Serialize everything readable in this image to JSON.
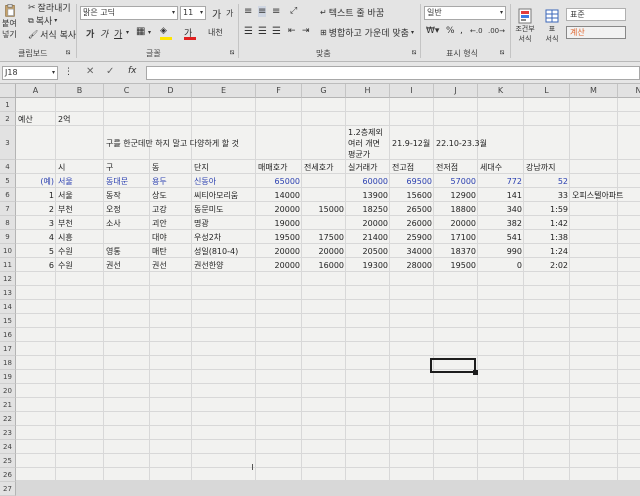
{
  "ribbon": {
    "clipboard": {
      "cut_label": "잘라내기",
      "copy_label": "복사",
      "paste_label": "붙여넣기",
      "format_painter_label": "서식 복사",
      "group_label": "클립보드"
    },
    "font": {
      "name": "맑은 고딕",
      "size": "11",
      "grow": "가",
      "shrink": "가",
      "bold": "가",
      "italic": "가",
      "underline": "가",
      "strike": "가",
      "font_color_letter": "가",
      "phonetic": "내천",
      "group_label": "글꼴"
    },
    "alignment": {
      "wrap_label": "텍스트 줄 바꿈",
      "merge_label": "병합하고 가운데 맞춤",
      "group_label": "맞춤"
    },
    "number": {
      "format": "일반",
      "percent": "%",
      "comma": ",",
      "group_label": "표시 형식"
    },
    "styles": {
      "conditional_label": "조건부",
      "conditional_label2": "서식",
      "table_label": "표",
      "table_label2": "서식",
      "normal_label": "표준",
      "calc_label": "계산"
    }
  },
  "formula_bar": {
    "name_box": "J18",
    "fx_label": "fx",
    "value": ""
  },
  "columns": [
    "A",
    "B",
    "C",
    "D",
    "E",
    "F",
    "G",
    "H",
    "I",
    "J",
    "K",
    "L",
    "M",
    "N"
  ],
  "rows": [
    "1",
    "2",
    "3",
    "4",
    "5",
    "6",
    "7",
    "8",
    "9",
    "10",
    "11",
    "12",
    "13",
    "14",
    "15",
    "16",
    "17",
    "18",
    "19",
    "20",
    "21",
    "22",
    "23",
    "24",
    "25",
    "26",
    "27"
  ],
  "sheet": {
    "a2": "예산",
    "b2": "2억",
    "c3": "구를 한군데만 하지 말고 다양하게 할 것",
    "h3": "1.2층제외\n여러 개면\n평균가",
    "i3": "21.9-12월",
    "j3": "22.10-23.3월",
    "headers": [
      "시",
      "구",
      "동",
      "단지",
      "매매호가",
      "전세호가",
      "실거래가",
      "전고점",
      "전저점",
      "세대수",
      "강남까지"
    ],
    "data_rows": [
      {
        "a": "(예)",
        "b": "서울",
        "c": "동대문",
        "d": "용두",
        "e": "신동아",
        "f": "65000",
        "g": "",
        "h": "60000",
        "i": "69500",
        "j": "57000",
        "k": "772",
        "l": "52",
        "m": ""
      },
      {
        "a": "1",
        "b": "서울",
        "c": "동작",
        "d": "상도",
        "e": "씨티아모리움",
        "f": "14000",
        "g": "",
        "h": "13900",
        "i": "15600",
        "j": "12900",
        "k": "141",
        "l": "33",
        "m": "오피스텔아파트"
      },
      {
        "a": "2",
        "b": "부천",
        "c": "오정",
        "d": "고강",
        "e": "동문미도",
        "f": "20000",
        "g": "15000",
        "h": "18250",
        "i": "26500",
        "j": "18800",
        "k": "340",
        "l": "1:59",
        "m": ""
      },
      {
        "a": "3",
        "b": "부천",
        "c": "소사",
        "d": "괴안",
        "e": "명광",
        "f": "19000",
        "g": "",
        "h": "20000",
        "i": "26000",
        "j": "20000",
        "k": "382",
        "l": "1:42",
        "m": ""
      },
      {
        "a": "4",
        "b": "시흥",
        "c": "",
        "d": "대야",
        "e": "우성2차",
        "f": "19500",
        "g": "17500",
        "h": "21400",
        "i": "25900",
        "j": "17100",
        "k": "541",
        "l": "1:38",
        "m": ""
      },
      {
        "a": "5",
        "b": "수원",
        "c": "영통",
        "d": "매탄",
        "e": "성일(810-4)",
        "f": "20000",
        "g": "20000",
        "h": "20500",
        "i": "34000",
        "j": "18370",
        "k": "990",
        "l": "1:24",
        "m": ""
      },
      {
        "a": "6",
        "b": "수원",
        "c": "권선",
        "d": "권선",
        "e": "권선한양",
        "f": "20000",
        "g": "16000",
        "h": "19300",
        "i": "28000",
        "j": "19500",
        "k": "0",
        "l": "2:02",
        "m": ""
      }
    ]
  },
  "colors": {
    "example_row_text": "#2a3fb0",
    "calc_style_text": "#e0632a",
    "normal_style_bg": "#ffffff",
    "calc_style_bg": "#f2f2f2",
    "ribbon_bg": "#e4e4e4"
  }
}
